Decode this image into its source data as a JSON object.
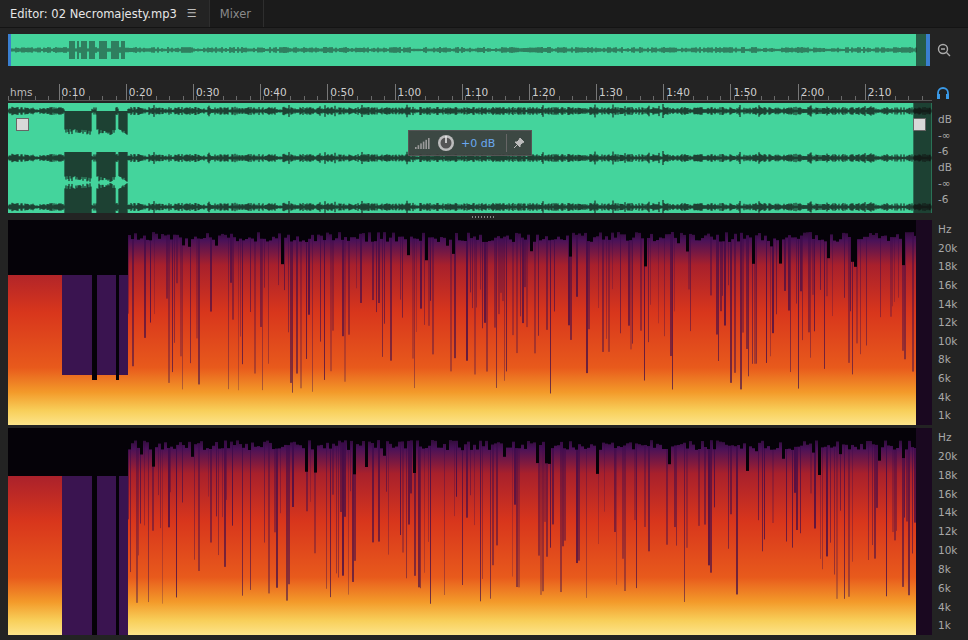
{
  "tabs": [
    {
      "label": "Editor: 02 Necromajesty.mp3",
      "selected": true,
      "menu": "☰"
    },
    {
      "label": "Mixer",
      "selected": false,
      "menu": ""
    }
  ],
  "ruler": {
    "unit": "hms",
    "ticks": [
      "0:10",
      "0:20",
      "0:30",
      "0:40",
      "0:50",
      "1:00",
      "1:10",
      "1:20",
      "1:30",
      "1:40",
      "1:50",
      "2:00",
      "2:10"
    ]
  },
  "waveform": {
    "channels": [
      {
        "labels": [
          "dB",
          "-∞",
          "-6"
        ]
      },
      {
        "labels": [
          "dB",
          "-∞",
          "-6"
        ]
      }
    ]
  },
  "hud": {
    "reading": "+0 dB"
  },
  "spectrogram": {
    "channels": [
      {
        "labels": [
          "Hz",
          "20k",
          "18k",
          "16k",
          "14k",
          "12k",
          "10k",
          "8k",
          "6k",
          "4k",
          "1k"
        ]
      },
      {
        "labels": [
          "Hz",
          "20k",
          "18k",
          "16k",
          "14k",
          "12k",
          "10k",
          "8k",
          "6k",
          "4k",
          "1k"
        ]
      }
    ]
  }
}
